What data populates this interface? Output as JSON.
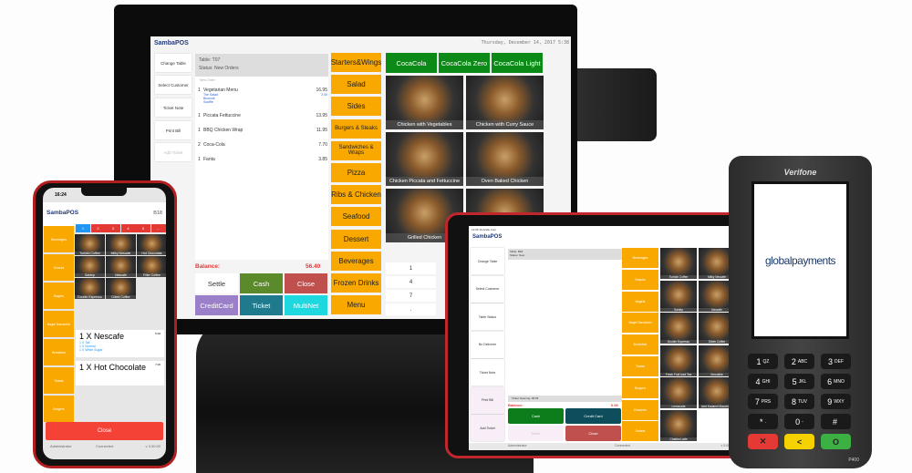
{
  "monitor": {
    "logo": "SambaPOS",
    "datetime": "Thursday, December 14, 2017 5:38",
    "left_buttons": [
      "Change Table",
      "Select Customer",
      "Ticket Note",
      "Print Bill",
      "Add Ticket"
    ],
    "ticket": {
      "table": "Table: T07",
      "status": "Status: New Orders",
      "section": "New Order",
      "items": [
        {
          "qty": "1",
          "name": "Vegetarian Menu",
          "price": "16.95",
          "subs": [
            "The Salad",
            "Broccoli",
            "Souffle"
          ],
          "sub_price": "2.00"
        },
        {
          "qty": "1",
          "name": "Piccata Fettuccine",
          "price": "13.95"
        },
        {
          "qty": "1",
          "name": "BBQ Chicken Wrap",
          "price": "11.95"
        },
        {
          "qty": "2",
          "name": "Coca-Cola",
          "price": "7.70"
        },
        {
          "qty": "1",
          "name": "Fanta",
          "price": "3.85"
        }
      ]
    },
    "balance_label": "Balance:",
    "balance": "56.40",
    "payment_buttons": [
      {
        "label": "Settle",
        "color": "#ffffff"
      },
      {
        "label": "Cash",
        "color": "#5a8a2a"
      },
      {
        "label": "Close",
        "color": "#c0504d"
      },
      {
        "label": "CreditCard",
        "color": "#9b7fc8"
      },
      {
        "label": "Ticket",
        "color": "#1e7a8c"
      },
      {
        "label": "MultiNet",
        "color": "#1ed8e0"
      }
    ],
    "categories": [
      "Starters&Wings",
      "Salad",
      "Sides",
      "Burgers & Steaks",
      "Sandwiches & Wraps",
      "Pizza",
      "Ribs & Chicken",
      "Seafood",
      "Dessert",
      "Beverages",
      "Frozen Drinks",
      "Menu"
    ],
    "drinks": [
      "CocaCola",
      "CocaCola Zero",
      "CocaCola Light"
    ],
    "products": [
      "Chicken with Vegetables",
      "Chicken with Curry Sauce",
      "Chicken Piccata and Fettuccine",
      "Oven Baked Chicken",
      "Grilled Chicken",
      ""
    ],
    "numpad": [
      "1",
      "4",
      "7",
      "."
    ]
  },
  "phone": {
    "time": "16:24",
    "logo": "SambaPOS",
    "table": "B18",
    "categories": [
      "Beverages",
      "Snacks",
      "Bagels",
      "Bagel Sandwich",
      "Breakfast",
      "Toasts",
      "Burgers"
    ],
    "pages": [
      "1",
      "2",
      "3",
      "4",
      "5",
      "..."
    ],
    "products": [
      "Turkish Coffee",
      "Milky Nescafe",
      "Hot Chocolate",
      "Sahlep",
      "Nescafe",
      "Filter Coffee",
      "Double Espresso",
      "Dibek Coffee"
    ],
    "orders": [
      {
        "title": "1 X Nescafe",
        "price": "5.00",
        "subs": [
          "1 X Tall",
          "1 X Normal",
          "1 X White Sugar"
        ]
      },
      {
        "title": "1 X Hot Chocolate",
        "price": "7.00",
        "subs": []
      }
    ],
    "close": "Close",
    "user": "Administrator",
    "status": "Connected",
    "version": "v 3.00.92"
  },
  "tablet": {
    "statusbar": "12:05  10 Aralık Cum",
    "logo": "SambaPOS",
    "left_buttons": [
      "Change Table",
      "Select Customer",
      "Table Status",
      "No Deliverer",
      "Ticket Note",
      "Print Bill",
      "Add Ticket"
    ],
    "table": "Table: B18",
    "status": "Status: New",
    "ticket_opening": "Ticket Opening: 09:05",
    "balance_label": "Balance:",
    "balance": "0.00",
    "buttons": [
      {
        "label": "Cash",
        "color": "#0c7d1a"
      },
      {
        "label": "Credit Card",
        "color": "#0e4d5c"
      },
      {
        "label": "Settle",
        "color": "#f7eef7"
      },
      {
        "label": "Close",
        "color": "#c0504d"
      }
    ],
    "categories": [
      "Beverages",
      "Snacks",
      "Bagels",
      "Bagel Sandwich",
      "Breakfast",
      "Toasts",
      "Burgers",
      "Desserts",
      "Salads"
    ],
    "products": [
      "Turkish Coffee",
      "Milky Nescafe",
      "Sahlep",
      "Nescafe",
      "Double Espresso",
      "Dibek Coffee",
      "Fresh Fruit Iced Tea",
      "Smoothie",
      "Lemonade",
      "Iced Karamel Macchiato",
      "Chaitea Latte"
    ],
    "user": "Administrator",
    "conn": "Connected",
    "version": "v 3.00"
  },
  "terminal": {
    "brand": "Verifone",
    "display": "globalpayments",
    "model": "P400",
    "keys": [
      [
        "1",
        "QZ"
      ],
      [
        "2",
        "ABC"
      ],
      [
        "3",
        "DEF"
      ],
      [
        "4",
        "GHI"
      ],
      [
        "5",
        "JKL"
      ],
      [
        "6",
        "MNO"
      ],
      [
        "7",
        "PRS"
      ],
      [
        "8",
        "TUV"
      ],
      [
        "9",
        "WXY"
      ],
      [
        "*",
        "."
      ],
      [
        "0",
        "-"
      ],
      [
        "#",
        ""
      ]
    ],
    "function_keys": [
      {
        "label": "✕",
        "color": "#e53935"
      },
      {
        "label": "<",
        "color": "#f5d100"
      },
      {
        "label": "O",
        "color": "#3cb043"
      }
    ]
  },
  "colors": {
    "accent_orange": "#f9a800",
    "samba_red": "#e53935",
    "samba_navy": "#233a7a"
  }
}
